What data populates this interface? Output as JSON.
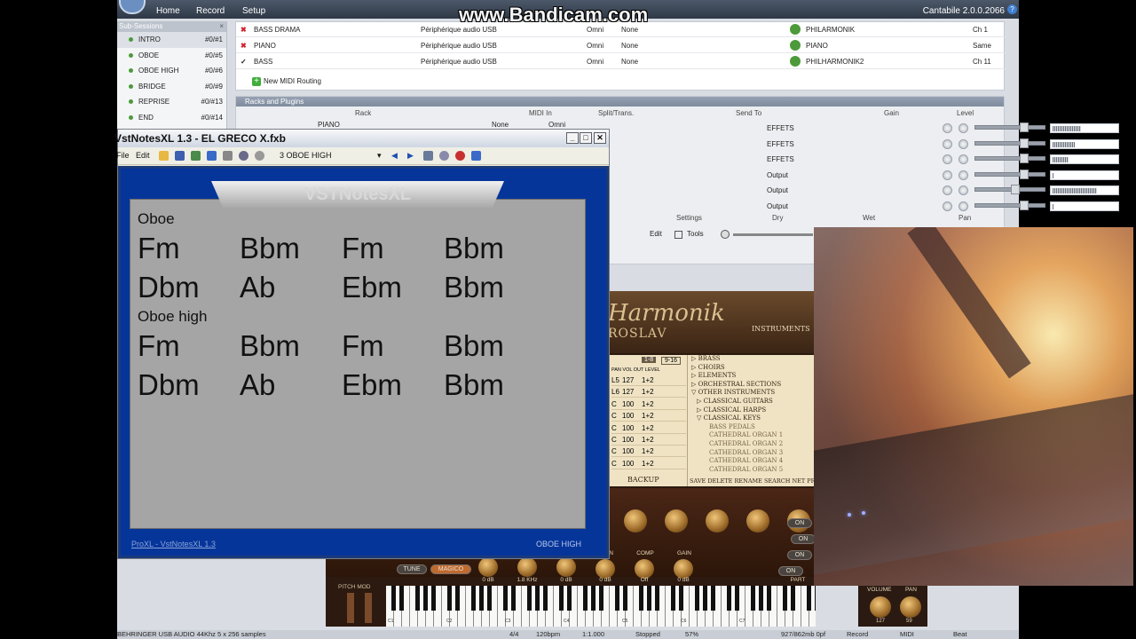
{
  "watermark": "www.Bandicam.com",
  "cantabile": {
    "menu": [
      "Home",
      "Record",
      "Setup"
    ],
    "version": "Cantabile 2.0.0.2066",
    "help": "?",
    "subsessions": {
      "title": "Sub-Sessions",
      "close": "×",
      "items": [
        {
          "name": "INTRO",
          "num": "#0/#1"
        },
        {
          "name": "OBOE",
          "num": "#0/#5"
        },
        {
          "name": "OBOE HIGH",
          "num": "#0/#6"
        },
        {
          "name": "BRIDGE",
          "num": "#0/#9"
        },
        {
          "name": "REPRISE",
          "num": "#0/#13"
        },
        {
          "name": "END",
          "num": "#0/#14"
        }
      ]
    },
    "routing": {
      "rows": [
        {
          "mark": "✖",
          "name": "BASS DRAMA",
          "device": "Périphérique audio USB",
          "channel": "Omni",
          "filter": "None",
          "target": "PHILARMONIK",
          "out": "Ch 1"
        },
        {
          "mark": "✖",
          "name": "PIANO",
          "device": "Périphérique audio USB",
          "channel": "Omni",
          "filter": "None",
          "target": "PIANO",
          "out": "Same"
        },
        {
          "mark": "✓",
          "name": "BASS",
          "device": "Périphérique audio USB",
          "channel": "Omni",
          "filter": "None",
          "target": "PHILHARMONIK2",
          "out": "Ch 11"
        }
      ],
      "new_label": "New MIDI Routing"
    },
    "racks": {
      "title": "Racks and Plugins",
      "headers": {
        "rack": "Rack",
        "midi_in": "MIDI In",
        "split": "Split/Trans.",
        "send_to": "Send To",
        "gain": "Gain",
        "level": "Level"
      },
      "first_rack": "PIANO",
      "first_midi": "None",
      "first_omni": "Omni",
      "rows": [
        {
          "send": "EFFETS",
          "level": 0.45
        },
        {
          "send": "EFFETS",
          "level": 0.35
        },
        {
          "send": "EFFETS",
          "level": 0.25
        },
        {
          "send": "Output",
          "level": 0.02
        },
        {
          "send": "Output",
          "level": 0.7
        },
        {
          "send": "Output",
          "level": 0.02
        }
      ],
      "bottom_headers": {
        "settings": "Settings",
        "dry": "Dry",
        "wet": "Wet",
        "pan": "Pan"
      },
      "edit": "Edit",
      "tools": "Tools"
    },
    "statusbar": {
      "audio": "BEHRINGER USB AUDIO 44Khz 5 x 256 samples",
      "time_sig": "4/4",
      "tempo": "120bpm",
      "position": "1:1.000",
      "state": "Stopped",
      "cpu": "57%",
      "memory": "927/862mb 0pf",
      "record": "Record",
      "midi": "MIDI",
      "beat": "Beat"
    }
  },
  "vstnotes": {
    "title": "VstNotesXL 1.3 - EL GRECO X.fxb",
    "menu_file": "File",
    "menu_edit": "Edit",
    "preset": "3 OBOE HIGH",
    "banner": "VSTNotesXL",
    "sections": [
      {
        "label": "Oboe",
        "lines": [
          [
            "Fm",
            "Bbm",
            "Fm",
            "Bbm"
          ],
          [
            "Dbm",
            "Ab",
            "Ebm",
            "Bbm"
          ]
        ]
      },
      {
        "label": "Oboe high",
        "lines": [
          [
            "Fm",
            "Bbm",
            "Fm",
            "Bbm"
          ],
          [
            "Dbm",
            "Ab",
            "Ebm",
            "Bbm"
          ]
        ]
      }
    ],
    "footer_left": "ProXL - VstNotesXL 1.3",
    "footer_right": "OBOE HIGH"
  },
  "philharmonik": {
    "brand": "Harmonik",
    "brand_sub": "ROSLAV",
    "instruments": "INSTRUMENTS",
    "tabs": [
      "1-8",
      "9-16"
    ],
    "col_headers": "PAN VOL OUT LEVEL",
    "parts": [
      {
        "pan": "L5",
        "vol": "127",
        "out": "1+2"
      },
      {
        "pan": "L6",
        "vol": "127",
        "out": "1+2"
      },
      {
        "pan": "C",
        "vol": "100",
        "out": "1+2"
      },
      {
        "pan": "C",
        "vol": "100",
        "out": "1+2"
      },
      {
        "pan": "C",
        "vol": "100",
        "out": "1+2"
      },
      {
        "pan": "C",
        "vol": "100",
        "out": "1+2"
      },
      {
        "pan": "C",
        "vol": "100",
        "out": "1+2"
      },
      {
        "pan": "C",
        "vol": "100",
        "out": "1+2"
      }
    ],
    "categories": [
      {
        "text": "▷ BRASS",
        "kind": "cat"
      },
      {
        "text": "▷ CHOIRS",
        "kind": "cat"
      },
      {
        "text": "▷ ELEMENTS",
        "kind": "cat"
      },
      {
        "text": "▷ ORCHESTRAL SECTIONS",
        "kind": "cat"
      },
      {
        "text": "▽ OTHER INSTRUMENTS",
        "kind": "cat"
      },
      {
        "text": "▷ CLASSICAL GUITARS",
        "kind": "sub"
      },
      {
        "text": "▷ CLASSICAL HARPS",
        "kind": "sub"
      },
      {
        "text": "▽ CLASSICAL KEYS",
        "kind": "sub"
      },
      {
        "text": "BASS PEDALS",
        "kind": "leaf"
      },
      {
        "text": "CATHEDRAL ORGAN 1",
        "kind": "leaf"
      },
      {
        "text": "CATHEDRAL ORGAN 2",
        "kind": "leaf"
      },
      {
        "text": "CATHEDRAL ORGAN 3",
        "kind": "leaf"
      },
      {
        "text": "CATHEDRAL ORGAN 4",
        "kind": "leaf"
      },
      {
        "text": "CATHEDRAL ORGAN 5",
        "kind": "leaf"
      }
    ],
    "backup": "BACKUP",
    "actions": "SAVE DELETE RENAME SEARCH NET PR",
    "tune": "TUNE",
    "magico": "MAGICO",
    "knob_labels": [
      "GAIN",
      "COMP",
      "GAIN"
    ],
    "values": [
      "0 dB",
      "1.8 KHz",
      "0 dB",
      "0 dB",
      "Off",
      "0 dB"
    ],
    "on_labels": [
      "ON",
      "ON",
      "ON",
      "ON"
    ],
    "pitch": "PITCH",
    "mod": "MOD",
    "part_label": "PART",
    "volume": "VOLUME",
    "pan": "PAN",
    "volume_value": "127",
    "pan_value": "59",
    "octaves": [
      "C1",
      "C2",
      "C3",
      "C4",
      "C5",
      "C6",
      "C7"
    ]
  }
}
